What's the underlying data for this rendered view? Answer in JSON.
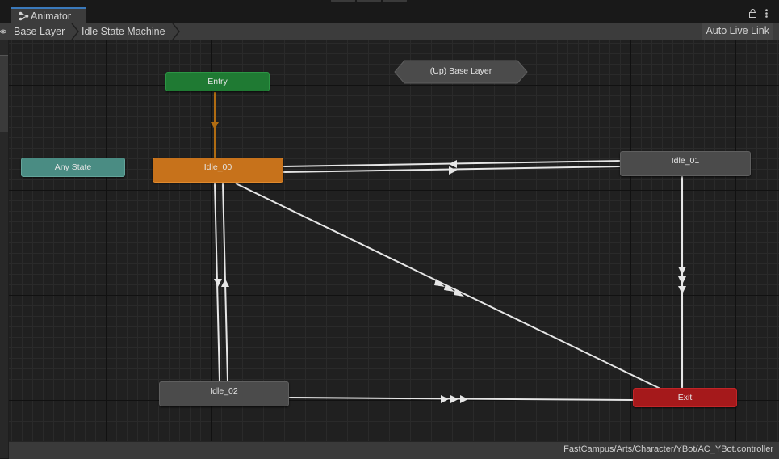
{
  "window": {
    "tab_title": "Animator",
    "tab_icon": "animator-graph-icon",
    "lock_icon": "lock-icon",
    "menu_icon": "kebab-menu-icon"
  },
  "breadcrumb": {
    "items": [
      "Base Layer",
      "Idle State Machine"
    ]
  },
  "toolbar": {
    "auto_live_link_label": "Auto Live Link"
  },
  "graph": {
    "parent_node": "(Up) Base Layer",
    "states": {
      "entry": "Entry",
      "any_state": "Any State",
      "idle_00": "Idle_00",
      "idle_01": "Idle_01",
      "idle_02": "Idle_02",
      "exit": "Exit"
    },
    "colors": {
      "entry": "#1f7a33",
      "any_state": "#4a8c83",
      "default_state": "#c7721b",
      "state": "#4b4b4b",
      "exit": "#a5191b",
      "default_transition": "#b06c12",
      "transition": "#e6e6e6"
    },
    "transitions": [
      {
        "from": "Entry",
        "to": "Idle_00",
        "kind": "default"
      },
      {
        "from": "Idle_01",
        "to": "Idle_00",
        "count": 1
      },
      {
        "from": "Idle_00",
        "to": "Idle_01",
        "count": 1
      },
      {
        "from": "Idle_00",
        "to": "Idle_02",
        "count": 1
      },
      {
        "from": "Idle_02",
        "to": "Idle_00",
        "count": 1
      },
      {
        "from": "Idle_00",
        "to": "Exit",
        "count": 2
      },
      {
        "from": "Idle_01",
        "to": "Exit",
        "count": 2
      },
      {
        "from": "Idle_02",
        "to": "Exit",
        "count": 3
      }
    ]
  },
  "status": {
    "asset_path": "FastCampus/Arts/Character/YBot/AC_YBot.controller"
  }
}
